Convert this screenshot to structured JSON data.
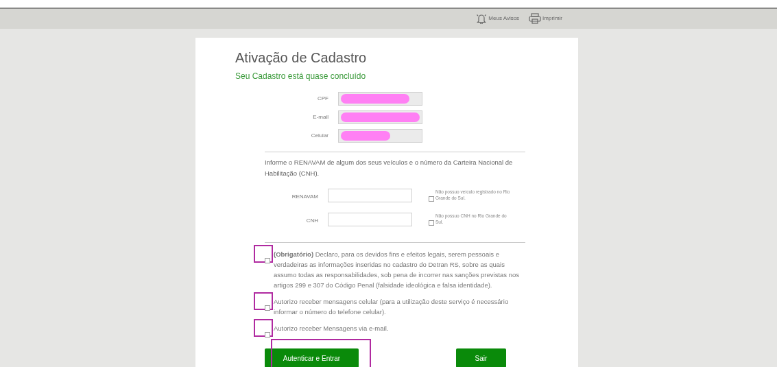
{
  "header": {
    "links": [
      {
        "kind": "bell",
        "label": "Meus Avisos"
      },
      {
        "kind": "printer",
        "label": "Imprimir"
      }
    ]
  },
  "title": "Ativação de Cadastro",
  "subtitle": "Seu Cadastro está quase concluído",
  "personal_fields": [
    {
      "label": "CPF",
      "redacted": true
    },
    {
      "label": "E-mail",
      "redacted": true
    },
    {
      "label": "Celular",
      "redacted": true
    }
  ],
  "instructions": "Informe o RENAVAM de algum dos seus veículos e o número da Carteira Nacional de Habilitação (CNH).",
  "vehicle_fields": [
    {
      "label": "RENAVAM",
      "option": "Não possuo veículo registrado no Rio Grande do Sul.",
      "checked": false
    },
    {
      "label": "CNH",
      "option": "Não possuo CNH no Rio Grande do Sul.",
      "checked": false
    }
  ],
  "consents": [
    {
      "text": "**(Obrigatório)** Declaro, para os devidos fins e efeitos legais, serem pessoais e verdadeiras as informações inseridas no cadastro do Detran RS, sobre as quais assumo todas as responsabilidades, sob pena de incorrer nas sanções previstas nos artigos 299 e 307 do Código Penal (falsidade ideológica e falsa identidade).",
      "checked": false,
      "highlighted": true
    },
    {
      "text": "Autorizo receber mensagens celular (para a utilização deste serviço é necessário informar o número do telefone celular).",
      "checked": false,
      "highlighted": true
    },
    {
      "text": "Autorizo receber Mensagens via e-mail.",
      "checked": false,
      "highlighted": true
    }
  ],
  "buttons": [
    {
      "label": "Autenticar e Entrar",
      "highlighted": true
    },
    {
      "label": "Sair",
      "highlighted": false
    }
  ]
}
